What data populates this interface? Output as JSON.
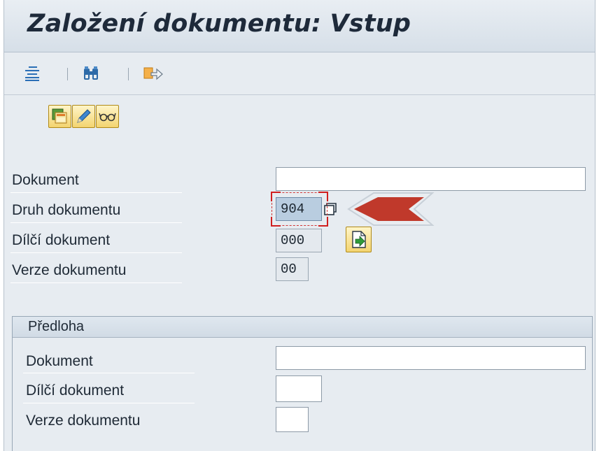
{
  "window": {
    "title": "Založení dokumentu: Vstup"
  },
  "toolbar": {
    "icons": [
      "align-text-icon",
      "binoculars-icon",
      "export-icon"
    ]
  },
  "app_buttons": [
    "new-document-icon",
    "edit-pencil-icon",
    "display-glasses-icon"
  ],
  "form": {
    "document": {
      "label": "Dokument",
      "value": ""
    },
    "document_type": {
      "label": "Druh dokumentu",
      "value": "904"
    },
    "document_part": {
      "label": "Dílčí dokument",
      "value": "000"
    },
    "document_version": {
      "label": "Verze dokumentu",
      "value": "00"
    }
  },
  "template_group": {
    "title": "Předloha",
    "document": {
      "label": "Dokument",
      "value": ""
    },
    "document_part": {
      "label": "Dílčí dokument",
      "value": ""
    },
    "document_version": {
      "label": "Verze dokumentu",
      "value": ""
    }
  },
  "colors": {
    "title_bg": "#dfe6ed",
    "app_button": "#f3d470",
    "highlight_arrow": "#c0392b",
    "focus_marker": "#d01f1f"
  }
}
